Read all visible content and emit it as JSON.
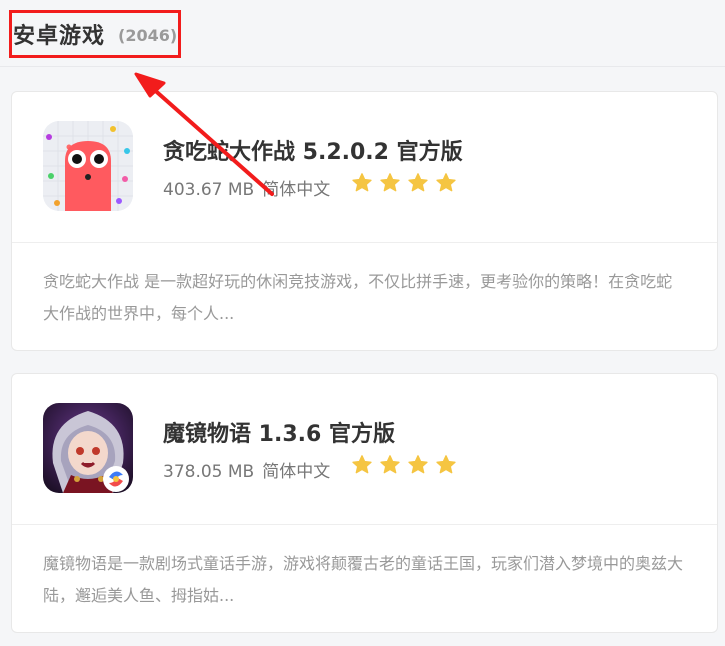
{
  "header": {
    "title": "安卓游戏",
    "count": "(2046)"
  },
  "games": [
    {
      "name": "贪吃蛇大作战 5.2.0.2 官方版",
      "size": "403.67 MB",
      "language": "简体中文",
      "rating": 4,
      "description": "贪吃蛇大作战 是一款超好玩的休闲竞技游戏，不仅比拼手速，更考验你的策略！在贪吃蛇大作战的世界中，每个人...",
      "icon": "snake-game-icon"
    },
    {
      "name": "魔镜物语 1.3.6 官方版",
      "size": "378.05 MB",
      "language": "简体中文",
      "rating": 4,
      "description": "魔镜物语是一款剧场式童话手游，游戏将颠覆古老的童话王国，玩家们潜入梦境中的奥兹大陆，邂逅美人鱼、拇指姑...",
      "icon": "magic-mirror-game-icon"
    }
  ],
  "colors": {
    "highlight_box": "#f21c1c",
    "star": "#f5c542",
    "arrow": "#f21c1c"
  }
}
